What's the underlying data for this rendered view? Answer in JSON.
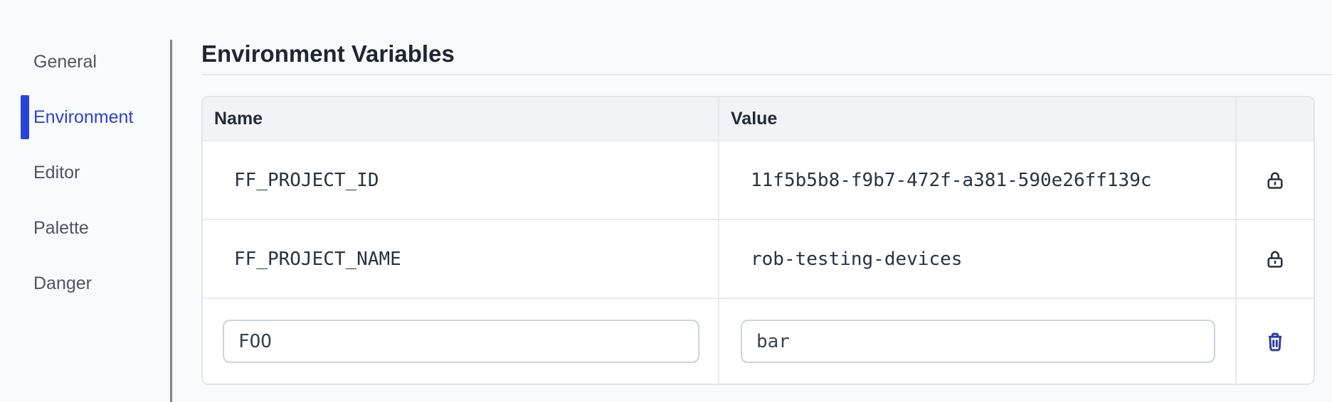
{
  "sidebar": {
    "items": [
      {
        "label": "General",
        "active": false
      },
      {
        "label": "Environment",
        "active": true
      },
      {
        "label": "Editor",
        "active": false
      },
      {
        "label": "Palette",
        "active": false
      },
      {
        "label": "Danger",
        "active": false
      }
    ]
  },
  "main": {
    "title": "Environment Variables",
    "table": {
      "headers": {
        "name": "Name",
        "value": "Value",
        "actions": ""
      },
      "rows": [
        {
          "name": "FF_PROJECT_ID",
          "value": "11f5b5b8-f9b7-472f-a381-590e26ff139c",
          "locked": true
        },
        {
          "name": "FF_PROJECT_NAME",
          "value": "rob-testing-devices",
          "locked": true
        }
      ],
      "draft_row": {
        "name": "FOO",
        "value": "bar"
      }
    }
  },
  "icons": {
    "row_locked": "lock-icon",
    "row_delete": "trash-icon"
  },
  "colors": {
    "accent_blue": "#2a43d9",
    "trash_blue": "#2c3b9e",
    "lock_dark": "#262e3d",
    "header_row_bg": "#f1f3f6",
    "table_border": "#e7eaee",
    "page_bg": "#f9fafb"
  }
}
